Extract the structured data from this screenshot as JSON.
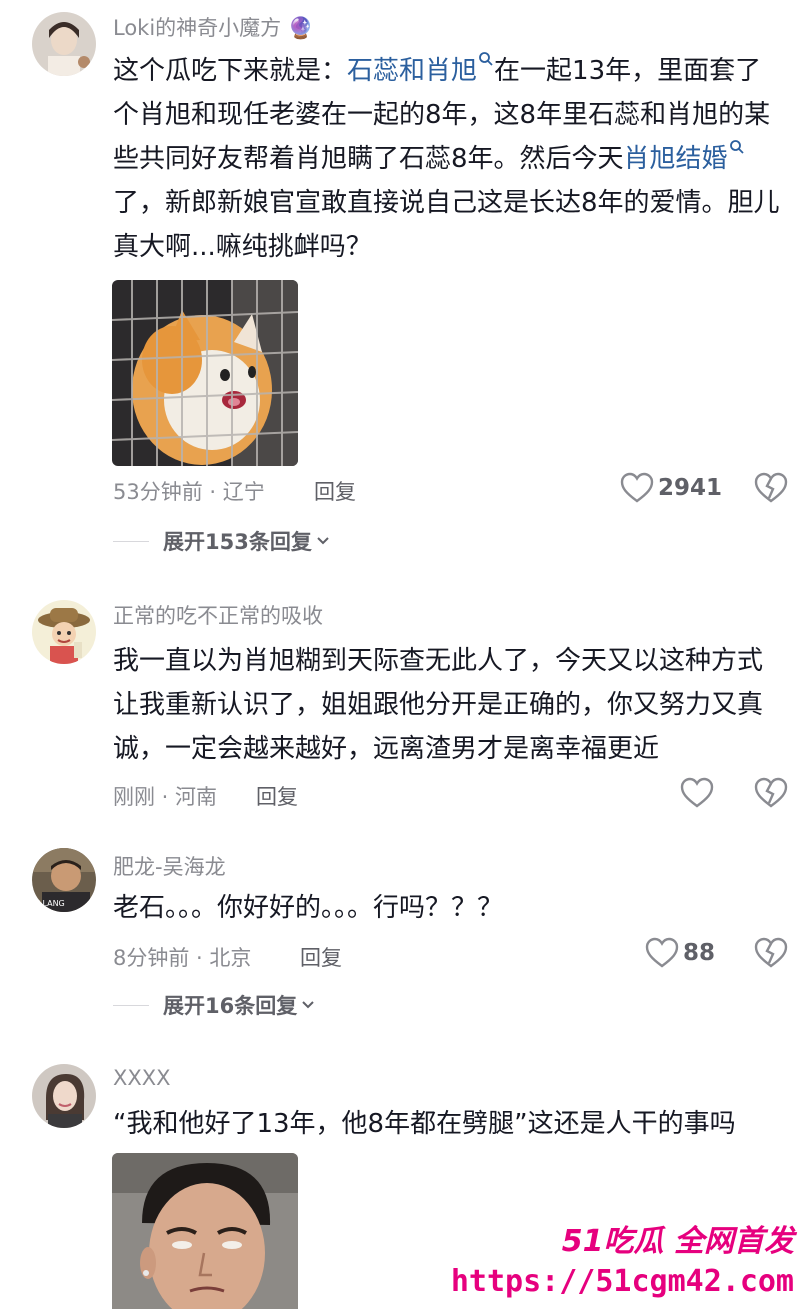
{
  "comments": [
    {
      "username": "Loki的神奇小魔方",
      "username_emoji": "🔮",
      "text_parts": [
        {
          "t": "这个瓜吃下来就是："
        },
        {
          "t": "石蕊和肖旭",
          "kw": true
        },
        {
          "t": "在一起13年，里面套了个肖旭和现任老婆在一起的8年，这8年里石蕊和肖旭的某些共同好友帮着肖旭瞒了石蕊8年。然后今天"
        },
        {
          "t": "肖旭结婚",
          "kw": true
        },
        {
          "t": "了，新郎新娘官宣敢直接说自己这是长达8年的爱情。胆儿真大啊...嘛纯挑衅吗？"
        }
      ],
      "has_image": "cat-in-cage",
      "time_location": "53分钟前 · 辽宁",
      "reply_label": "回复",
      "like_count": "2941",
      "expand_label": "展开153条回复"
    },
    {
      "username": "正常的吃不正常的吸收",
      "text": "我一直以为肖旭糊到天际查无此人了，今天又以这种方式让我重新认识了，姐姐跟他分开是正确的，你又努力又真诚，一定会越来越好，远离渣男才是离幸福更近",
      "time_location": "刚刚 · 河南",
      "reply_label": "回复",
      "like_count": ""
    },
    {
      "username": "肥龙-吴海龙",
      "avatar_text": "LLANG",
      "text": "老石。。。你好好的。。。行吗？？？",
      "time_location": "8分钟前 · 北京",
      "reply_label": "回复",
      "like_count": "88",
      "expand_label": "展开16条回复"
    },
    {
      "username": "XXXX",
      "text": "“我和他好了13年，他8年都在劈腿”这还是人干的事吗",
      "has_image": "man-meme-face"
    }
  ],
  "watermark": {
    "brand": "51吃瓜 全网首发",
    "url": "https://51cgm42.com"
  },
  "icons": {
    "like": "heart-outline-icon",
    "dislike": "broken-heart-icon",
    "keyword_search": "search-small-icon",
    "expand": "chevron-down-icon"
  },
  "colors": {
    "keyword": "#2b5f9e",
    "meta": "#8a8b91",
    "watermark": "#e6007e"
  }
}
